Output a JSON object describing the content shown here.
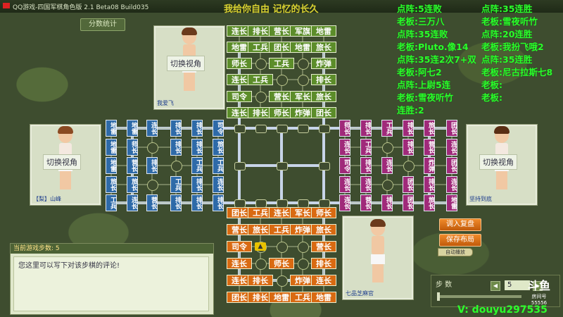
{
  "window": {
    "title": "QQ游戏-四国军棋角色版 2.1 Beta08 Build035"
  },
  "slogan": "我给你自由 记忆的长久",
  "stats_button": "分数统计",
  "players": {
    "top": {
      "view_label": "切换视角",
      "name": "我爱飞"
    },
    "left": {
      "view_label": "切换视角",
      "name": "【梨】山峰"
    },
    "right": {
      "view_label": "切换视角",
      "name": "坚持到底"
    },
    "bottom": {
      "name": "七品芝麻官"
    }
  },
  "scoreboard": [
    {
      "text": "点阵:5连败",
      "col": 0
    },
    {
      "text": "点阵:35连胜",
      "col": 1
    },
    {
      "text": "老板:三万八",
      "col": 0
    },
    {
      "text": "老板:雪夜听竹",
      "col": 1
    },
    {
      "text": "点阵:35连败",
      "col": 0
    },
    {
      "text": "点阵:20连胜",
      "col": 1
    },
    {
      "text": "老板:Pluto.像14",
      "col": 0
    },
    {
      "text": "老板:我扮飞哦2",
      "col": 1
    },
    {
      "text": "点阵:35连2次7+双",
      "col": 0
    },
    {
      "text": "点阵:35连胜",
      "col": 1
    },
    {
      "text": "老板:阿七2",
      "col": 0
    },
    {
      "text": "老板:尼古拉斯七8",
      "col": 1
    },
    {
      "text": "点阵:上尉5连",
      "col": 0
    },
    {
      "text": "老板:",
      "col": 1
    },
    {
      "text": "老板:雪夜听竹",
      "col": 0
    },
    {
      "text": "老板:",
      "col": 1
    },
    {
      "text": "连胜:2",
      "col": 0
    }
  ],
  "comment": {
    "header": "当前游戏步数: 5",
    "text": "您这里可以写下对该步棋的评论!"
  },
  "buttons": {
    "replay": "调入复盘",
    "save_layout": "保存布局",
    "auto": "自动播放"
  },
  "steps": {
    "label": "步   数",
    "value": "5"
  },
  "logo": {
    "big": "斗鱼",
    "small": "房间号",
    "room": "55556"
  },
  "watermark": "V: douyu297535",
  "board": {
    "top": [
      [
        "连长",
        "排长",
        "营长",
        "军旗",
        "地雷"
      ],
      [
        "地雷",
        "工兵",
        "团长",
        "地雷",
        "旅长"
      ],
      [
        "师长",
        "",
        "工兵",
        "",
        "炸弹"
      ],
      [
        "连长",
        "工兵",
        "",
        "",
        "排长"
      ],
      [
        "司令",
        "",
        "营长",
        "军长",
        "旅长"
      ],
      [
        "连长",
        "排长",
        "师长",
        "炸弹",
        "团长"
      ]
    ],
    "bottom": [
      [
        "团长",
        "工兵",
        "连长",
        "军长",
        "师长"
      ],
      [
        "营长",
        "旅长",
        "工兵",
        "炸弹",
        "旅长"
      ],
      [
        "司令",
        "",
        "",
        "",
        "营长"
      ],
      [
        "连长",
        "",
        "师长",
        "",
        "排长"
      ],
      [
        "连长",
        "排长",
        "",
        "炸弹",
        "连长"
      ],
      [
        "团长",
        "排长",
        "地雷",
        "工兵",
        "地雷"
      ]
    ],
    "left_cols": [
      [
        "地雷",
        "地雷",
        "地雷",
        "旅长",
        "工兵"
      ],
      [
        "地雷",
        "师长",
        "营长",
        "旅长",
        "连长"
      ],
      [
        "连长",
        "",
        "排长",
        "",
        "营长"
      ],
      [
        "排长",
        "排长",
        "",
        "工兵",
        "排长"
      ],
      [
        "排长",
        "排长",
        "工兵",
        "排长",
        "排长"
      ],
      [
        "司令",
        "旅长",
        "工兵",
        "连长",
        "排长"
      ]
    ],
    "right_cols": [
      [
        "师长",
        "连长",
        "司令",
        "连长",
        "连长"
      ],
      [
        "排长",
        "工兵",
        "排长",
        "连长",
        "营长"
      ],
      [
        "工兵",
        "",
        "连长",
        "",
        "排长"
      ],
      [
        "排长",
        "排长",
        "",
        "团长",
        "团长"
      ],
      [
        "旅长",
        "营长",
        "炸弹",
        "排长",
        "旅长"
      ],
      [
        "团长",
        "连长",
        "团长",
        "连长",
        "地雷"
      ]
    ]
  },
  "colors": {
    "top": "#5c8d2a",
    "bottom": "#d96a12",
    "left": "#2e6aa8",
    "right": "#a02a7a",
    "score": "#2bff2b"
  }
}
